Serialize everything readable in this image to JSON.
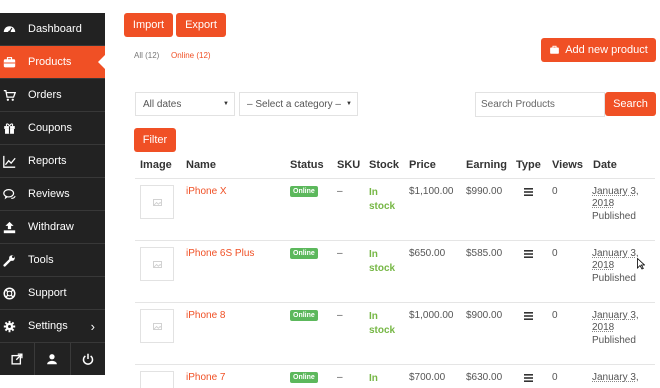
{
  "sidebar": {
    "items": [
      {
        "label": "Dashboard",
        "icon": "dashboard-icon"
      },
      {
        "label": "Products",
        "icon": "briefcase-icon",
        "active": true
      },
      {
        "label": "Orders",
        "icon": "cart-icon"
      },
      {
        "label": "Coupons",
        "icon": "gift-icon"
      },
      {
        "label": "Reports",
        "icon": "chart-icon"
      },
      {
        "label": "Reviews",
        "icon": "comments-icon"
      },
      {
        "label": "Withdraw",
        "icon": "upload-icon"
      },
      {
        "label": "Tools",
        "icon": "wrench-icon"
      },
      {
        "label": "Support",
        "icon": "lifebuoy-icon"
      },
      {
        "label": "Settings",
        "icon": "gear-icon"
      }
    ],
    "bottom": [
      "external-link-icon",
      "user-icon",
      "power-icon"
    ]
  },
  "toolbar": {
    "import_label": "Import",
    "export_label": "Export",
    "add_label": "Add new product"
  },
  "status_links": {
    "all": "All (12)",
    "online": "Online (12)"
  },
  "filters": {
    "dates": "All dates",
    "category": "– Select a category –",
    "search_placeholder": "Search Products",
    "search_button": "Search",
    "filter_button": "Filter"
  },
  "table": {
    "headers": [
      "Image",
      "Name",
      "Status",
      "SKU",
      "Stock",
      "Price",
      "Earning",
      "Type",
      "Views",
      "Date"
    ],
    "rows": [
      {
        "name": "iPhone X",
        "status": "Online",
        "sku": "–",
        "stock": "In stock",
        "price": "$1,100.00",
        "earning": "$990.00",
        "views": "0",
        "date": "January 3, 2018",
        "published": "Published"
      },
      {
        "name": "iPhone 6S Plus",
        "status": "Online",
        "sku": "–",
        "stock": "In stock",
        "price": "$650.00",
        "earning": "$585.00",
        "views": "0",
        "date": "January 3, 2018",
        "published": "Published"
      },
      {
        "name": "iPhone 8",
        "status": "Online",
        "sku": "–",
        "stock": "In stock",
        "price": "$1,000.00",
        "earning": "$900.00",
        "views": "0",
        "date": "January 3, 2018",
        "published": "Published"
      },
      {
        "name": "iPhone 7",
        "status": "Online",
        "sku": "–",
        "stock": "In",
        "price": "$700.00",
        "earning": "$630.00",
        "views": "0",
        "date": "January 3,",
        "published": ""
      }
    ]
  },
  "colors": {
    "accent": "#f05025",
    "sidebar_bg": "#222222",
    "online_badge": "#5cb85c",
    "in_stock": "#76b745"
  }
}
